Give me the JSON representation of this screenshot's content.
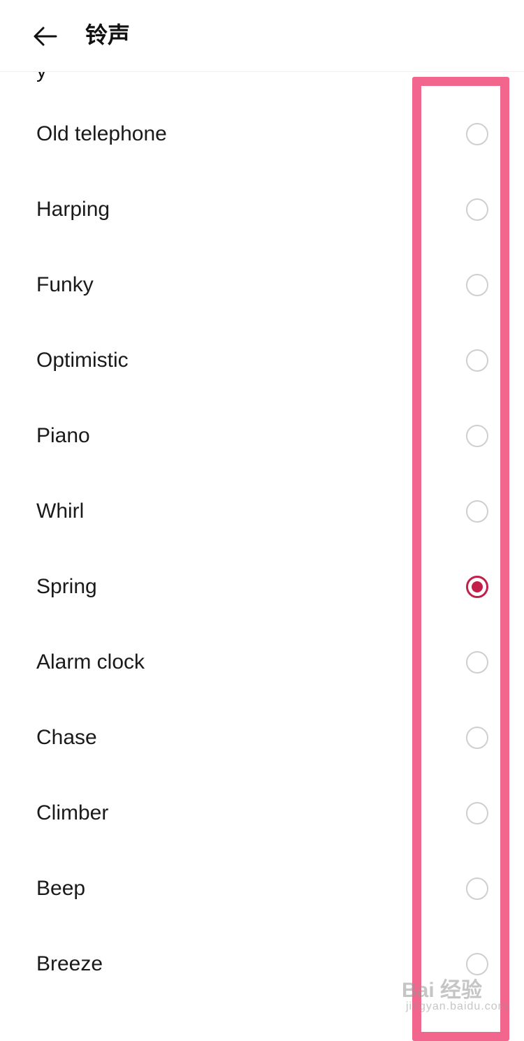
{
  "header": {
    "title": "铃声"
  },
  "list": {
    "partial_top_label": "y",
    "items": [
      {
        "label": "Old telephone",
        "selected": false
      },
      {
        "label": "Harping",
        "selected": false
      },
      {
        "label": "Funky",
        "selected": false
      },
      {
        "label": "Optimistic",
        "selected": false
      },
      {
        "label": "Piano",
        "selected": false
      },
      {
        "label": "Whirl",
        "selected": false
      },
      {
        "label": "Spring",
        "selected": true
      },
      {
        "label": "Alarm clock",
        "selected": false
      },
      {
        "label": "Chase",
        "selected": false
      },
      {
        "label": "Climber",
        "selected": false
      },
      {
        "label": "Beep",
        "selected": false
      },
      {
        "label": "Breeze",
        "selected": false
      }
    ]
  },
  "icons": {
    "back": "arrow-left-icon",
    "radio_selected": "radio-checked-icon",
    "radio_unselected": "radio-unchecked-icon"
  },
  "colors": {
    "accent": "#c21f4a",
    "annotation_box": "#f2668e",
    "radio_border": "#cfcfcf"
  },
  "watermark": {
    "brand": "Bai 经验",
    "sub": "jingyan.baidu.com"
  }
}
